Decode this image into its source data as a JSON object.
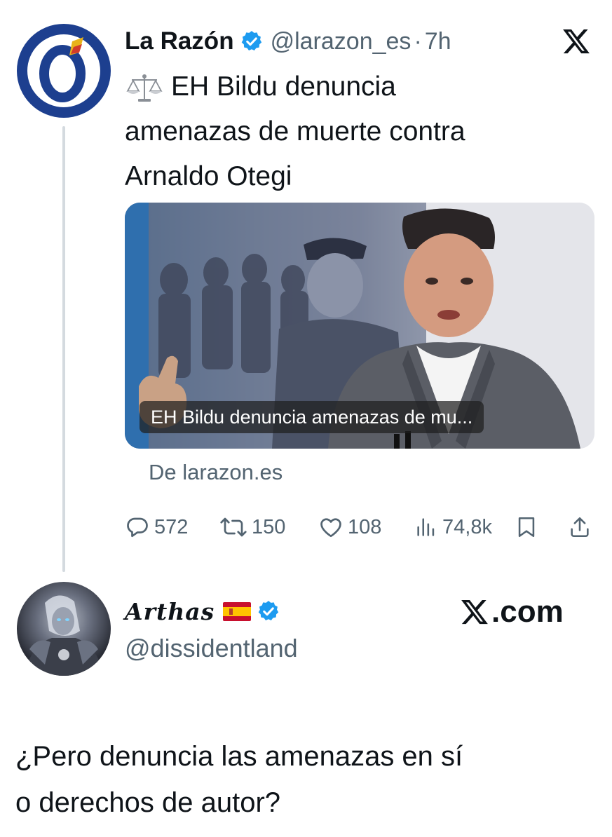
{
  "tweet": {
    "author_name": "La Razón",
    "handle": "@larazon_es",
    "separator": "·",
    "time": "7h",
    "text_lines": [
      "EH Bildu denuncia",
      "amenazas de muerte contra",
      "Arnaldo Otegi"
    ],
    "card_caption": "EH Bildu denuncia amenazas de mu...",
    "card_source": "De larazon.es",
    "stats": {
      "replies": "572",
      "reposts": "150",
      "likes": "108",
      "views": "74,8k"
    }
  },
  "reply": {
    "author_name": "Arthas",
    "handle": "@dissidentland",
    "watermark": ".com",
    "text_lines": [
      "¿Pero denuncia las amenazas en sí",
      "o derechos de autor?"
    ]
  },
  "colors": {
    "text": "#0f1419",
    "secondary": "#536471",
    "verified": "#1d9bf0",
    "brand_blue": "#1d3f8f",
    "thread_line": "#d4dadf"
  },
  "icons": [
    "scale-icon",
    "verified-icon",
    "x-logo-icon",
    "reply-icon",
    "repost-icon",
    "like-icon",
    "views-icon",
    "bookmark-icon",
    "share-icon",
    "spain-flag-icon"
  ]
}
